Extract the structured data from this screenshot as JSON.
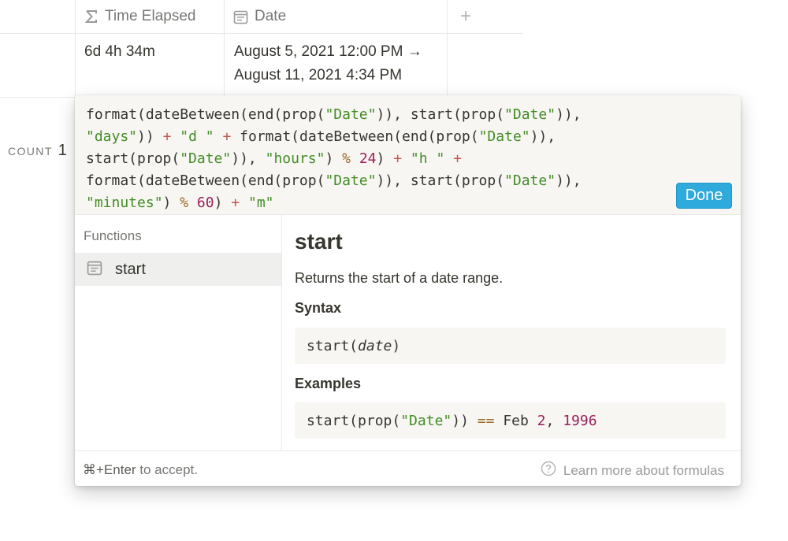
{
  "table": {
    "columns": [
      {
        "label": "Time Elapsed",
        "icon": "sigma-icon"
      },
      {
        "label": "Date",
        "icon": "calendar-icon"
      }
    ],
    "add_column": "+",
    "row": {
      "time_elapsed": "6d 4h 34m",
      "date_line1": "August 5, 2021 12:00 PM →",
      "date_line2": "August 11, 2021 4:34 PM"
    },
    "count_label": "COUNT",
    "count_value": "1"
  },
  "formula_editor": {
    "formula": "format(dateBetween(end(prop(\"Date\")), start(prop(\"Date\")), \"days\")) + \"d \" + format(dateBetween(end(prop(\"Date\")), start(prop(\"Date\")), \"hours\") % 24) + \"h \" + format(dateBetween(end(prop(\"Date\")), start(prop(\"Date\")), \"minutes\") % 60) + \"m\"",
    "done_label": "Done"
  },
  "functions_panel": {
    "title": "Functions",
    "items": [
      {
        "label": "start",
        "icon": "calendar-icon",
        "selected": true
      }
    ]
  },
  "docs": {
    "title": "start",
    "description": "Returns the start of a date range.",
    "syntax_heading": "Syntax",
    "syntax_fn": "start(",
    "syntax_arg": "date",
    "syntax_close": ")",
    "examples_heading": "Examples",
    "example": "start(prop(\"Date\")) == Feb 2, 1996"
  },
  "footer": {
    "shortcut": "⌘+Enter",
    "hint_rest": " to accept.",
    "learn_more": "Learn more about formulas"
  },
  "colors": {
    "accent": "#2eaadc",
    "string": "#448c26",
    "number": "#9b1f5a",
    "muted_text": "#787774"
  }
}
